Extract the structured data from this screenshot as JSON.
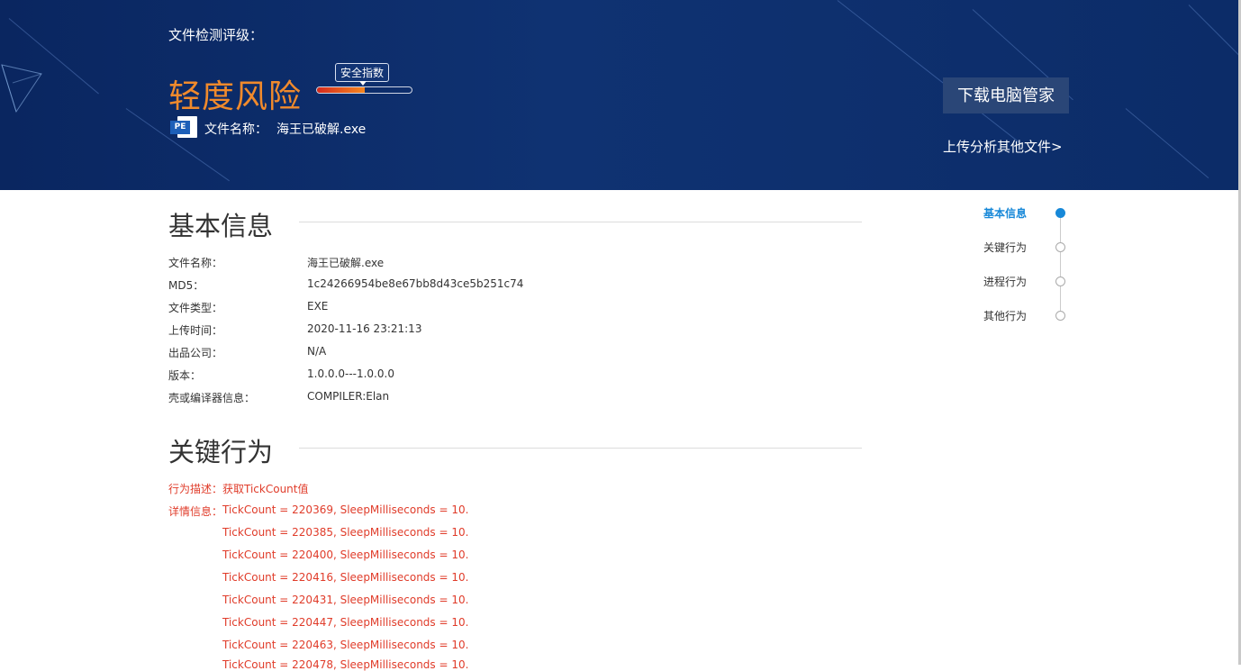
{
  "header": {
    "rating_label": "文件检测评级：",
    "risk_level": "轻度风险",
    "safety_tip": "安全指数",
    "safety_level": 0.5,
    "pe_badge": "PE",
    "filename_label": "文件名称：",
    "filename_value": "海王已破解.exe",
    "download_button": "下载电脑管家",
    "upload_link": "上传分析其他文件>"
  },
  "basic_info": {
    "title": "基本信息",
    "rows": [
      {
        "key": "文件名称：",
        "value": "海王已破解.exe"
      },
      {
        "key": "MD5：",
        "value": "1c24266954be8e67bb8d43ce5b251c74"
      },
      {
        "key": "文件类型：",
        "value": "EXE"
      },
      {
        "key": "上传时间：",
        "value": "2020-11-16 23:21:13"
      },
      {
        "key": "出品公司：",
        "value": "N/A"
      },
      {
        "key": "版本：",
        "value": "1.0.0.0---1.0.0.0"
      },
      {
        "key": "壳或编译器信息：",
        "value": "COMPILER:Elan"
      }
    ]
  },
  "key_behavior": {
    "title": "关键行为",
    "desc_label": "行为描述：",
    "desc_value": "获取TickCount值",
    "detail_label": "详情信息：",
    "details": [
      "TickCount = 220369, SleepMilliseconds = 10.",
      "TickCount = 220385, SleepMilliseconds = 10.",
      "TickCount = 220400, SleepMilliseconds = 10.",
      "TickCount = 220416, SleepMilliseconds = 10.",
      "TickCount = 220431, SleepMilliseconds = 10.",
      "TickCount = 220447, SleepMilliseconds = 10.",
      "TickCount = 220463, SleepMilliseconds = 10.",
      "TickCount = 220478, SleepMilliseconds = 10."
    ]
  },
  "side_nav": {
    "items": [
      {
        "label": "基本信息",
        "active": true
      },
      {
        "label": "关键行为",
        "active": false
      },
      {
        "label": "进程行为",
        "active": false
      },
      {
        "label": "其他行为",
        "active": false
      }
    ]
  },
  "colors": {
    "banner": "#0b2a63",
    "risk": "#f08a2c",
    "red_text": "#e03c2a",
    "nav_active": "#1788d8"
  }
}
